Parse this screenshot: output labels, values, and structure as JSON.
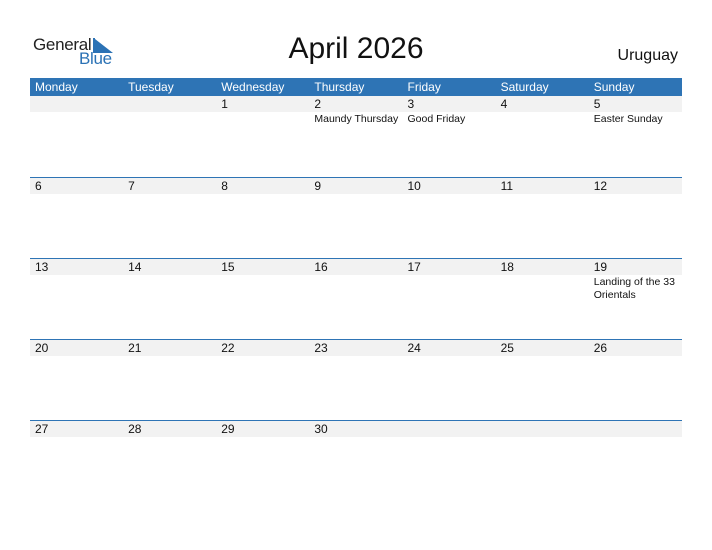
{
  "brand": {
    "line1": "General",
    "line2": "Blue",
    "accent_color": "#2e74b5"
  },
  "title": "April 2026",
  "country": "Uruguay",
  "weekdays": [
    "Monday",
    "Tuesday",
    "Wednesday",
    "Thursday",
    "Friday",
    "Saturday",
    "Sunday"
  ],
  "weeks": [
    [
      {
        "day": "",
        "holiday": ""
      },
      {
        "day": "",
        "holiday": ""
      },
      {
        "day": "1",
        "holiday": ""
      },
      {
        "day": "2",
        "holiday": "Maundy Thursday"
      },
      {
        "day": "3",
        "holiday": "Good Friday"
      },
      {
        "day": "4",
        "holiday": ""
      },
      {
        "day": "5",
        "holiday": "Easter Sunday"
      }
    ],
    [
      {
        "day": "6",
        "holiday": ""
      },
      {
        "day": "7",
        "holiday": ""
      },
      {
        "day": "8",
        "holiday": ""
      },
      {
        "day": "9",
        "holiday": ""
      },
      {
        "day": "10",
        "holiday": ""
      },
      {
        "day": "11",
        "holiday": ""
      },
      {
        "day": "12",
        "holiday": ""
      }
    ],
    [
      {
        "day": "13",
        "holiday": ""
      },
      {
        "day": "14",
        "holiday": ""
      },
      {
        "day": "15",
        "holiday": ""
      },
      {
        "day": "16",
        "holiday": ""
      },
      {
        "day": "17",
        "holiday": ""
      },
      {
        "day": "18",
        "holiday": ""
      },
      {
        "day": "19",
        "holiday": "Landing of the 33 Orientals"
      }
    ],
    [
      {
        "day": "20",
        "holiday": ""
      },
      {
        "day": "21",
        "holiday": ""
      },
      {
        "day": "22",
        "holiday": ""
      },
      {
        "day": "23",
        "holiday": ""
      },
      {
        "day": "24",
        "holiday": ""
      },
      {
        "day": "25",
        "holiday": ""
      },
      {
        "day": "26",
        "holiday": ""
      }
    ],
    [
      {
        "day": "27",
        "holiday": ""
      },
      {
        "day": "28",
        "holiday": ""
      },
      {
        "day": "29",
        "holiday": ""
      },
      {
        "day": "30",
        "holiday": ""
      },
      {
        "day": "",
        "holiday": ""
      },
      {
        "day": "",
        "holiday": ""
      },
      {
        "day": "",
        "holiday": ""
      }
    ]
  ]
}
